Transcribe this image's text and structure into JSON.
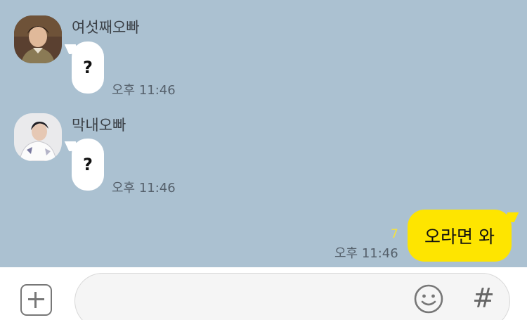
{
  "messages": [
    {
      "sender": "여섯째오빠",
      "text": "?",
      "time": "오후 11:46"
    },
    {
      "sender": "막내오빠",
      "text": "?",
      "time": "오후 11:46"
    }
  ],
  "my_message": {
    "text": "오라면 와",
    "time": "오후 11:46",
    "unread": "7"
  },
  "colors": {
    "background": "#abc1d1",
    "incoming_bubble": "#ffffff",
    "outgoing_bubble": "#fee500",
    "unread_count": "#f7e23a",
    "input_bar": "#ffffff"
  },
  "icons": {
    "attach": "plus-square-icon",
    "emoji": "smiley-icon",
    "tag": "hash-icon"
  },
  "input": {
    "value": "",
    "hash_label": "#"
  }
}
